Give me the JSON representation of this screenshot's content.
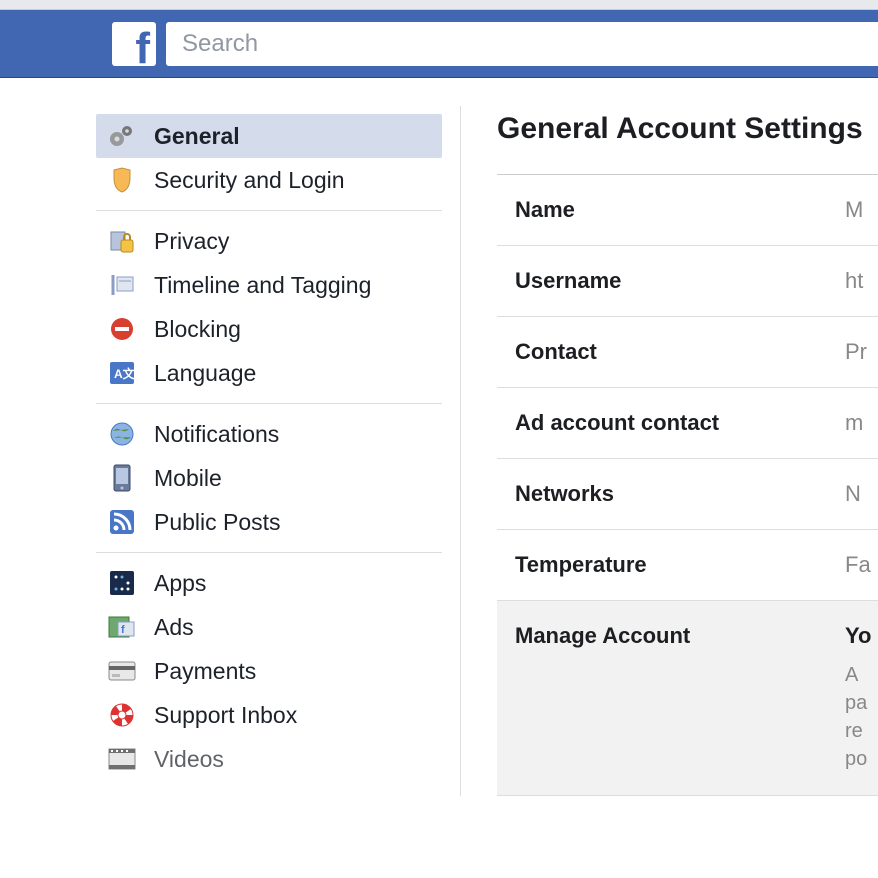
{
  "header": {
    "search_placeholder": "Search"
  },
  "sidebar": {
    "groups": [
      {
        "items": [
          {
            "label": "General",
            "icon": "gears-icon",
            "active": true
          },
          {
            "label": "Security and Login",
            "icon": "shield-icon",
            "active": false
          }
        ]
      },
      {
        "items": [
          {
            "label": "Privacy",
            "icon": "lock-icon",
            "active": false
          },
          {
            "label": "Timeline and Tagging",
            "icon": "timeline-icon",
            "active": false
          },
          {
            "label": "Blocking",
            "icon": "block-icon",
            "active": false
          },
          {
            "label": "Language",
            "icon": "language-icon",
            "active": false
          }
        ]
      },
      {
        "items": [
          {
            "label": "Notifications",
            "icon": "globe-icon",
            "active": false
          },
          {
            "label": "Mobile",
            "icon": "mobile-icon",
            "active": false
          },
          {
            "label": "Public Posts",
            "icon": "rss-icon",
            "active": false
          }
        ]
      },
      {
        "items": [
          {
            "label": "Apps",
            "icon": "apps-icon",
            "active": false
          },
          {
            "label": "Ads",
            "icon": "ads-icon",
            "active": false
          },
          {
            "label": "Payments",
            "icon": "payments-icon",
            "active": false
          },
          {
            "label": "Support Inbox",
            "icon": "support-icon",
            "active": false
          },
          {
            "label": "Videos",
            "icon": "videos-icon",
            "active": false
          }
        ]
      }
    ]
  },
  "main": {
    "title": "General Account Settings",
    "rows": [
      {
        "label": "Name",
        "value": "M",
        "highlight": false
      },
      {
        "label": "Username",
        "value": "ht",
        "highlight": false
      },
      {
        "label": "Contact",
        "value": "Pr",
        "highlight": false
      },
      {
        "label": "Ad account contact",
        "value": "m",
        "highlight": false
      },
      {
        "label": "Networks",
        "value": "N",
        "highlight": false
      },
      {
        "label": "Temperature",
        "value": "Fa",
        "highlight": false
      },
      {
        "label": "Manage Account",
        "value": "Yo",
        "sub": "A\npa\nre\npo",
        "highlight": true
      }
    ]
  },
  "colors": {
    "brand": "#4267b2",
    "sidebar_active": "#d4dcec"
  }
}
